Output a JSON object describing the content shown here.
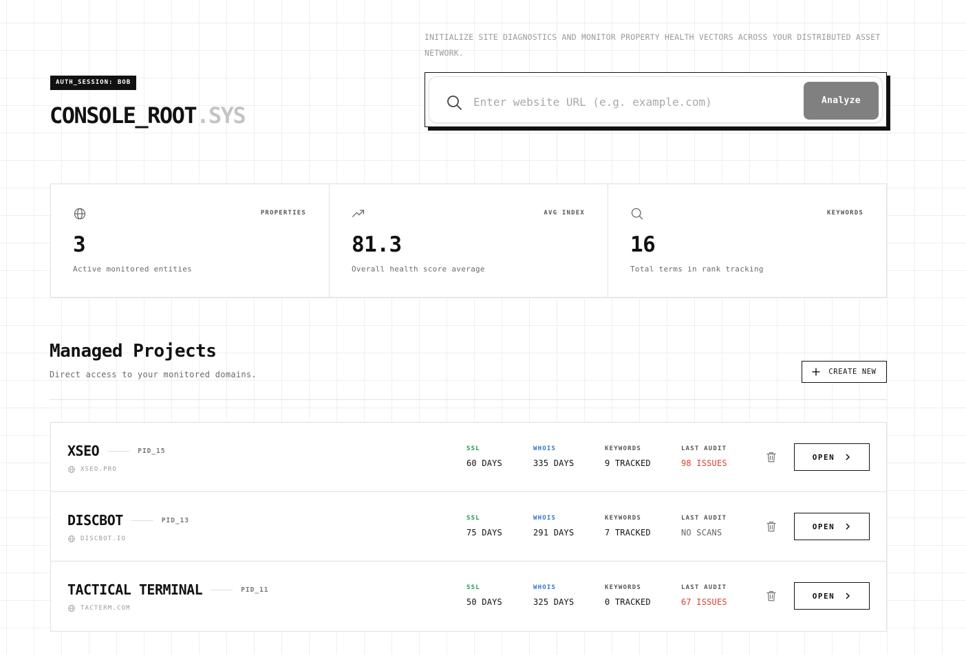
{
  "header": {
    "session_badge": "AUTH_SESSION: BOB",
    "brand_main": "CONSOLE_ROOT",
    "brand_suffix": ".SYS",
    "intro": "INITIALIZE SITE DIAGNOSTICS AND MONITOR PROPERTY HEALTH VECTORS ACROSS YOUR DISTRIBUTED ASSET NETWORK."
  },
  "search": {
    "placeholder": "Enter website URL (e.g. example.com)",
    "value": "",
    "button_label": "Analyze",
    "icon": "search-icon"
  },
  "stats": [
    {
      "icon": "globe-icon",
      "label": "PROPERTIES",
      "value": "3",
      "description": "Active monitored entities"
    },
    {
      "icon": "trending-up-icon",
      "label": "AVG INDEX",
      "value": "81.3",
      "description": "Overall health score average"
    },
    {
      "icon": "search-icon",
      "label": "KEYWORDS",
      "value": "16",
      "description": "Total terms in rank tracking"
    }
  ],
  "projects_section": {
    "title": "Managed Projects",
    "subtitle": "Direct access to your monitored domains.",
    "create_label": "CREATE NEW"
  },
  "metric_labels": {
    "ssl": "SSL",
    "whois": "WHOIS",
    "keywords": "KEYWORDS",
    "last_audit": "LAST AUDIT"
  },
  "colors": {
    "ssl": "#1e9a4f",
    "whois": "#2f76c8",
    "issues": "#e03c2e",
    "muted_label": "#555555",
    "no_scans": "#666666"
  },
  "projects": [
    {
      "name": "XSEO",
      "pid": "PID_15",
      "domain": "XSEO.PRO",
      "ssl": "60 DAYS",
      "whois": "335 DAYS",
      "keywords": "9 TRACKED",
      "audit": "98 ISSUES",
      "audit_status": "issues",
      "open_label": "OPEN"
    },
    {
      "name": "DISCBOT",
      "pid": "PID_13",
      "domain": "DISCBOT.IO",
      "ssl": "75 DAYS",
      "whois": "291 DAYS",
      "keywords": "7 TRACKED",
      "audit": "NO SCANS",
      "audit_status": "none",
      "open_label": "OPEN"
    },
    {
      "name": "TACTICAL TERMINAL",
      "pid": "PID_11",
      "domain": "TACTERM.COM",
      "ssl": "50 DAYS",
      "whois": "325 DAYS",
      "keywords": "0 TRACKED",
      "audit": "67 ISSUES",
      "audit_status": "issues",
      "open_label": "OPEN"
    }
  ]
}
